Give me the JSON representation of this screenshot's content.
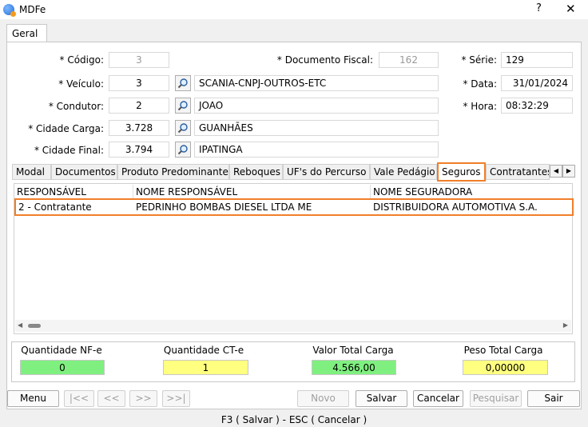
{
  "window": {
    "title": "MDFe",
    "help_label": "?",
    "close_label": "✕"
  },
  "main_tab": {
    "label": "Geral"
  },
  "form": {
    "codigo_label": "* Código:",
    "codigo_value": "3",
    "doc_fiscal_label": "* Documento Fiscal:",
    "doc_fiscal_value": "162",
    "serie_label": "* Série:",
    "serie_value": "129",
    "veiculo_label": "* Veículo:",
    "veiculo_code": "3",
    "veiculo_desc": "SCANIA-CNPJ-OUTROS-ETC",
    "data_label": "* Data:",
    "data_value": "31/01/2024",
    "condutor_label": "* Condutor:",
    "condutor_code": "2",
    "condutor_desc": "JOAO",
    "hora_label": "* Hora:",
    "hora_value": "08:32:29",
    "cidade_carga_label": "* Cidade Carga:",
    "cidade_carga_code": "3.728",
    "cidade_carga_desc": "GUANHÃES",
    "cidade_final_label": "* Cidade Final:",
    "cidade_final_code": "3.794",
    "cidade_final_desc": "IPATINGA"
  },
  "sub_tabs": [
    "Modal",
    "Documentos",
    "Produto Predominante",
    "Reboques",
    "UF's do Percurso",
    "Vale Pedágio",
    "Seguros",
    "Contratantes"
  ],
  "selected_sub_tab": "Seguros",
  "grid": {
    "columns": [
      "RESPONSÁVEL",
      "NOME RESPONSÁVEL",
      "NOME SEGURADORA"
    ],
    "rows": [
      [
        "2 - Contratante",
        "PEDRINHO BOMBAS DIESEL LTDA ME",
        "DISTRIBUIDORA AUTOMOTIVA S.A."
      ]
    ]
  },
  "totals": {
    "qtd_nfe_label": "Quantidade NF-e",
    "qtd_nfe_value": "0",
    "qtd_cte_label": "Quantidade CT-e",
    "qtd_cte_value": "1",
    "valor_label": "Valor Total Carga",
    "valor_value": "4.566,00",
    "peso_label": "Peso Total Carga",
    "peso_value": "0,00000",
    "colors": {
      "green": "#7ff07f",
      "yellow": "#ffff80"
    }
  },
  "buttons": {
    "menu": "Menu",
    "first": "|<<",
    "prev": "<<",
    "next": ">>",
    "last": ">>|",
    "novo": "Novo",
    "salvar": "Salvar",
    "cancelar": "Cancelar",
    "pesquisar": "Pesquisar",
    "sair": "Sair"
  },
  "status_bar": "F3 ( Salvar )  -  ESC ( Cancelar )",
  "accent_color": "#f07f2a"
}
